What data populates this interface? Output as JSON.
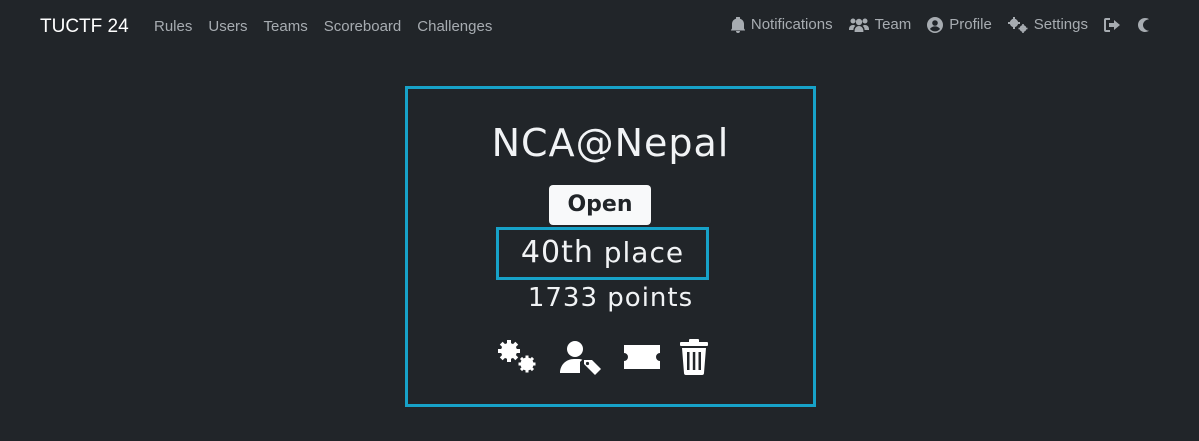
{
  "nav": {
    "brand": "TUCTF 24",
    "left_items": [
      "Rules",
      "Users",
      "Teams",
      "Scoreboard",
      "Challenges"
    ],
    "notifications_label": "Notifications",
    "team_label": "Team",
    "profile_label": "Profile",
    "settings_label": "Settings",
    "icons": [
      "bell-icon",
      "users-icon",
      "user-circle-icon",
      "cogs-icon",
      "sign-out-icon",
      "moon-icon"
    ]
  },
  "team": {
    "name": "NCA@Nepal",
    "status_badge": "Open",
    "place_number": "40th",
    "place_suffix": "place",
    "points_number": "1733",
    "points_suffix": "points"
  },
  "actions": {
    "icons": [
      "settings-cogs-icon",
      "user-tag-icon",
      "ticket-icon",
      "trash-icon"
    ]
  },
  "colors": {
    "background": "#212529",
    "accent_border": "#17a2c8"
  }
}
